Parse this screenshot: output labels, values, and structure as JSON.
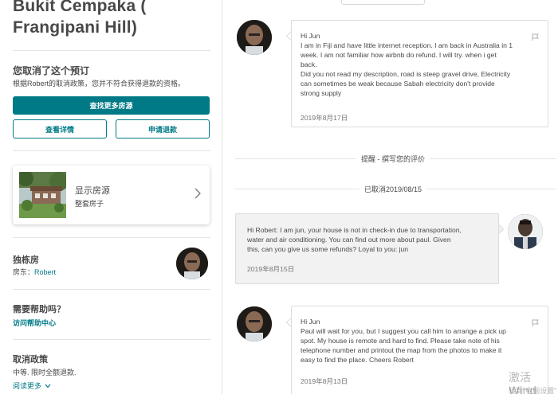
{
  "listing": {
    "title_line1": "Bukit Cempaka (",
    "title_line2": "Frangipani Hill)"
  },
  "cancellation": {
    "heading": "您取消了这个预订",
    "subtext": "根据Robert的取消政策，您并不符合获得退款的资格。",
    "primary_button": "查找更多房源",
    "details_button": "查看详情",
    "refund_button": "申请退款"
  },
  "property_card": {
    "title": "显示房源",
    "subtitle": "整套房子",
    "chevron_icon": "chevron-right-icon"
  },
  "host": {
    "heading": "独栋房",
    "prefix": "房东：",
    "name": "Robert"
  },
  "help": {
    "heading": "需要帮助吗？",
    "link": "访问帮助中心"
  },
  "policy": {
    "heading": "取消政策",
    "text": "中等. 限时全额退款.",
    "read_more": "阅读更多"
  },
  "messages": [
    {
      "lines": [
        "Hi Jun",
        "I am in Fiji and have little internet reception. I am back in Australia in 1",
        "week.  I am not familiar how airbnb do refund. I will try. when i get",
        "back.",
        "Did you not read my description, road is steep gravel drive, Electricity",
        "can sometimes be weak because Sabah electricity don't provide",
        "strong supply"
      ],
      "date": "2019年8月17日"
    },
    {
      "lines": [
        "Hi Robert: I am jun, your house is not in check-in due to transportation,",
        "water and air conditioning. You can find out more about paul. Given",
        "this, can you give us some refunds? Loyal to you: jun"
      ],
      "date": "2019年8月15日"
    },
    {
      "lines": [
        "Hi Jun",
        "Paul will wait for you, but I suggest you call him to arrange a pick up",
        "spot. My house is remote and hard to find. Please take note of his",
        "telephone number and printout the map from the photos to make it",
        "easy to find the place. Cheers Robert"
      ],
      "date": "2019年8月13日"
    }
  ],
  "separators": {
    "review_reminder": "提醒 - 撰写您的评价",
    "cancelled": "已取消2019/08/15"
  },
  "watermark": {
    "line1": "激活 Wind",
    "line2": "转到\"电脑设置\""
  },
  "colors": {
    "accent": "#007a87",
    "text": "#484848",
    "muted": "#767676"
  }
}
